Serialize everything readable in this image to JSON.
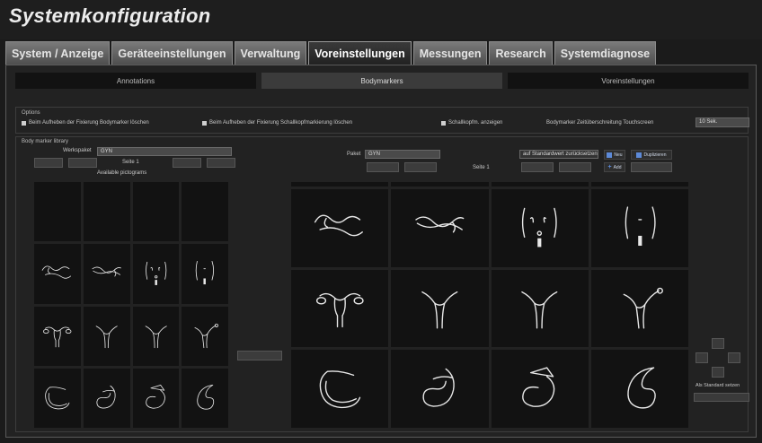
{
  "app": {
    "title": "Systemkonfiguration"
  },
  "tabs": [
    {
      "label": "System / Anzeige",
      "active": false
    },
    {
      "label": "Geräteeinstellungen",
      "active": false
    },
    {
      "label": "Verwaltung",
      "active": false
    },
    {
      "label": "Voreinstellungen",
      "active": true
    },
    {
      "label": "Messungen",
      "active": false
    },
    {
      "label": "Research",
      "active": false
    },
    {
      "label": "Systemdiagnose",
      "active": false
    }
  ],
  "subtabs": [
    {
      "label": "Annotations",
      "active": false
    },
    {
      "label": "Bodymarkers",
      "active": true
    },
    {
      "label": "Voreinstellungen",
      "active": false
    }
  ],
  "options": {
    "title": "Options",
    "items": [
      "Beim Aufheben der Fixierung Bodymarker löschen",
      "Beim Aufheben der Fixierung Schallkopfmarkierung löschen",
      "Schallkopfm. anzeigen"
    ],
    "timeout_label": "Bodymarker Zeitüberschreitung Touchscreen",
    "timeout_value": "10 Sek."
  },
  "library": {
    "title": "Body marker library",
    "werkspaket_label": "Werkspaket",
    "werkspaket_value": "GYN",
    "left_page": "Seite 1",
    "available_label": "Available pictograms",
    "paket_label": "Paket",
    "paket_value": "GYN",
    "right_page": "Seite 1",
    "reset_label": "auf Standardwert zurücksetzen",
    "neu_label": "Neu",
    "duplicate_label": "Duplizieren",
    "add_label": "Add",
    "standard_label": "Als Standard setzen"
  },
  "colors": {
    "accent": "#5d8ad8",
    "panel": "#222222",
    "tile": "#121212"
  },
  "pictograms": [
    "empty",
    "empty",
    "empty",
    "empty",
    "uterus-side",
    "uterus-side-2",
    "pelvis-front",
    "pelvis-front-2",
    "uterus-ovaries",
    "uterus",
    "uterus",
    "uterus-tilt",
    "fetus-1",
    "fetus-2",
    "fetus-3",
    "fetus-4"
  ]
}
